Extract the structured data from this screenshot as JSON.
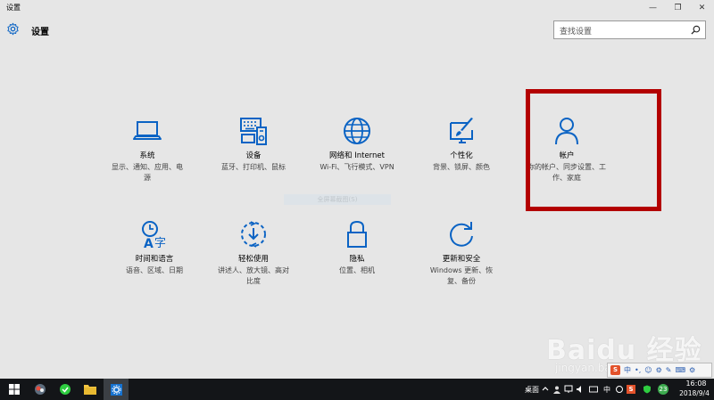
{
  "window": {
    "title": "设置",
    "controls": {
      "minimize": "—",
      "maximize": "❐",
      "close": "✕"
    }
  },
  "header": {
    "app_title": "设置",
    "search_placeholder": "查找设置"
  },
  "categories": [
    {
      "name": "系统",
      "desc_lines": [
        "显示、通知、应用、电",
        "源"
      ],
      "icon": "laptop-icon"
    },
    {
      "name": "设备",
      "desc_lines": [
        "蓝牙、打印机、鼠标"
      ],
      "icon": "devices-icon"
    },
    {
      "name": "网络和 Internet",
      "desc_lines": [
        "Wi-Fi、飞行模式、VPN"
      ],
      "icon": "globe-icon"
    },
    {
      "name": "个性化",
      "desc_lines": [
        "背景、锁屏、颜色"
      ],
      "icon": "paint-icon"
    },
    {
      "name": "帐户",
      "desc_lines": [
        "你的帐户、同步设置、工",
        "作、家庭"
      ],
      "icon": "person-icon"
    },
    {
      "name": "时间和语言",
      "desc_lines": [
        "语音、区域、日期"
      ],
      "icon": "time-language-icon"
    },
    {
      "name": "轻松使用",
      "desc_lines": [
        "讲述人、放大镜、高对",
        "比度"
      ],
      "icon": "ease-of-access-icon"
    },
    {
      "name": "隐私",
      "desc_lines": [
        "位置、相机"
      ],
      "icon": "lock-icon"
    },
    {
      "name": "更新和安全",
      "desc_lines": [
        "Windows 更新、恢",
        "复、备份"
      ],
      "icon": "refresh-icon"
    }
  ],
  "hint": "全屏幕截图(S)",
  "watermark": {
    "logo": "Baidu 经验",
    "url": "jingyan.baidu.com"
  },
  "ime": {
    "s": "S",
    "lang": "中",
    "items": [
      "中",
      "•,",
      "☺",
      "⚙",
      "✎",
      "⌨",
      "⚙"
    ]
  },
  "taskbar": {
    "desktop_label": "桌面",
    "badge": "23",
    "time": "16:08",
    "date": "2018/9/4"
  },
  "colors": {
    "accent": "#0a63c4",
    "highlight_border": "#b30000",
    "background": "#e6e6e6",
    "taskbar": "#131518"
  }
}
